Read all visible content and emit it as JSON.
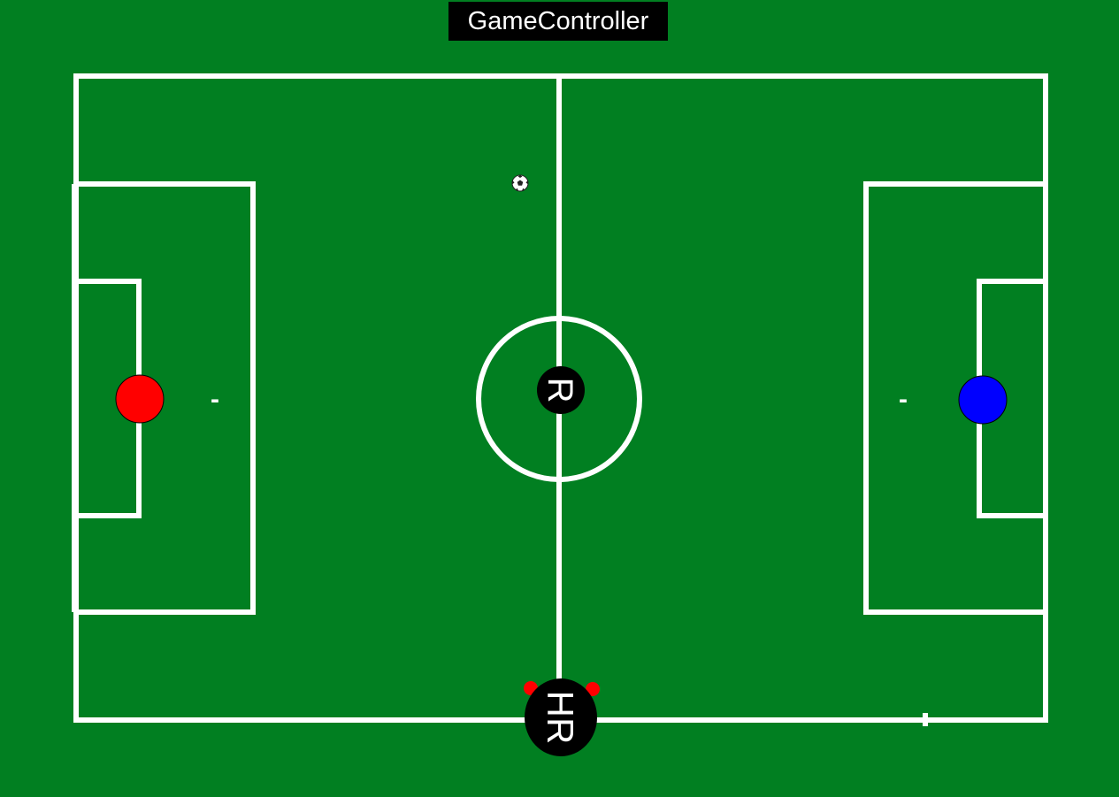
{
  "header": {
    "title": "GameController"
  },
  "colors": {
    "grass": "#017f21",
    "lines": "#ffffff",
    "team_left": "#ff0000",
    "team_right": "#0000ff",
    "referee": "#000000"
  },
  "field": {
    "left_player_label": "-",
    "right_player_label": "-",
    "center_referee_label": "R",
    "head_referee_label": "HR",
    "ball_icon": "soccer-ball-icon"
  }
}
